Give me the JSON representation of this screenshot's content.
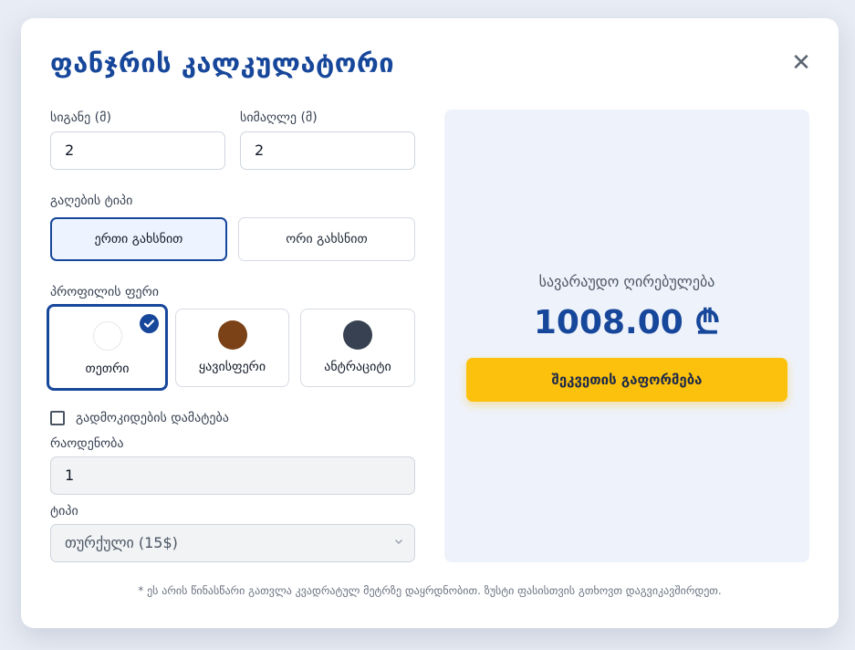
{
  "modal": {
    "title": "ფანჯრის კალკულატორი",
    "close_glyph": "✕"
  },
  "dimensions": {
    "width_label": "სიგანე (მ)",
    "width_value": "2",
    "height_label": "სიმაღლე (მ)",
    "height_value": "2"
  },
  "opening": {
    "label": "გაღების ტიპი",
    "options": [
      "ერთი გახსნით",
      "ორი გახსნით"
    ],
    "selected_index": 0
  },
  "profile_color": {
    "label": "პროფილის ფერი",
    "options": [
      {
        "name": "თეთრი",
        "color": "#ffffff"
      },
      {
        "name": "ყავისფერი",
        "color": "#7a4216"
      },
      {
        "name": "ანტრაციტი",
        "color": "#374151"
      }
    ],
    "selected_index": 0,
    "check_icon": "check-icon"
  },
  "sill": {
    "checkbox_label": "გადმოკიდების დამატება",
    "checked": false,
    "quantity_label": "რაოდენობა",
    "quantity_value": "1",
    "type_label": "ტიპი",
    "type_value": "თურქული (15$)"
  },
  "estimate": {
    "label": "სავარაუდო ღირებულება",
    "value": "1008.00 ₾",
    "order_button": "შეკვეთის გაფორმება"
  },
  "footnote": "* ეს არის წინასწარი გათვლა კვადრატულ მეტრზე დაყრდნობით. ზუსტი ფასისთვის გთხოვთ დაგვიკავშირდეთ.",
  "colors": {
    "brand_blue": "#17479a",
    "accent_yellow": "#fcc10c",
    "panel_bg": "#eef2fb"
  }
}
